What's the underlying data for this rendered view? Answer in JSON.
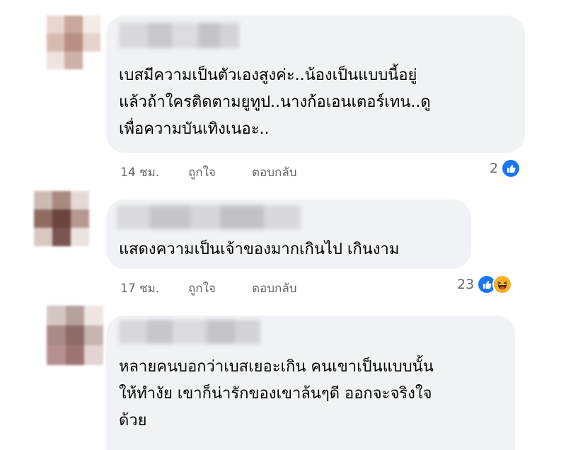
{
  "comments": [
    {
      "text_lines": [
        "เบสมีความเป็นตัวเองสูงค่ะ..น้องเป็นแบบนี้อยู่",
        "แล้วถ้าใครติดตามยูทูป..นางก้อเอนเตอร์เทน..ดู",
        "เพื่อความบันเทิงเนอะ.."
      ],
      "time": "14 ชม.",
      "like_label": "ถูกใจ",
      "reply_label": "ตอบกลับ",
      "reaction_count": "2",
      "reactions": [
        "like-icon"
      ]
    },
    {
      "text_lines": [
        "แสดงความเป็นเจ้าของมากเกินไป เกินงาม"
      ],
      "time": "17 ชม.",
      "like_label": "ถูกใจ",
      "reply_label": "ตอบกลับ",
      "reaction_count": "23",
      "reactions": [
        "like-icon",
        "haha-icon"
      ]
    },
    {
      "text_lines": [
        "หลายคนบอกว่าเบสเยอะเกิน คนเขาเป็นแบบนั้น",
        "ให้ทำงัย เขาก็น่ารักของเขาล้นๆดี ออกจะจริงใจ",
        "ด้วย"
      ]
    }
  ],
  "colors": {
    "bubble": "#f0f2f5",
    "text": "#050505",
    "meta": "#65676b",
    "like_blue": "#1877f2",
    "haha_yellow": "#f7b125"
  }
}
